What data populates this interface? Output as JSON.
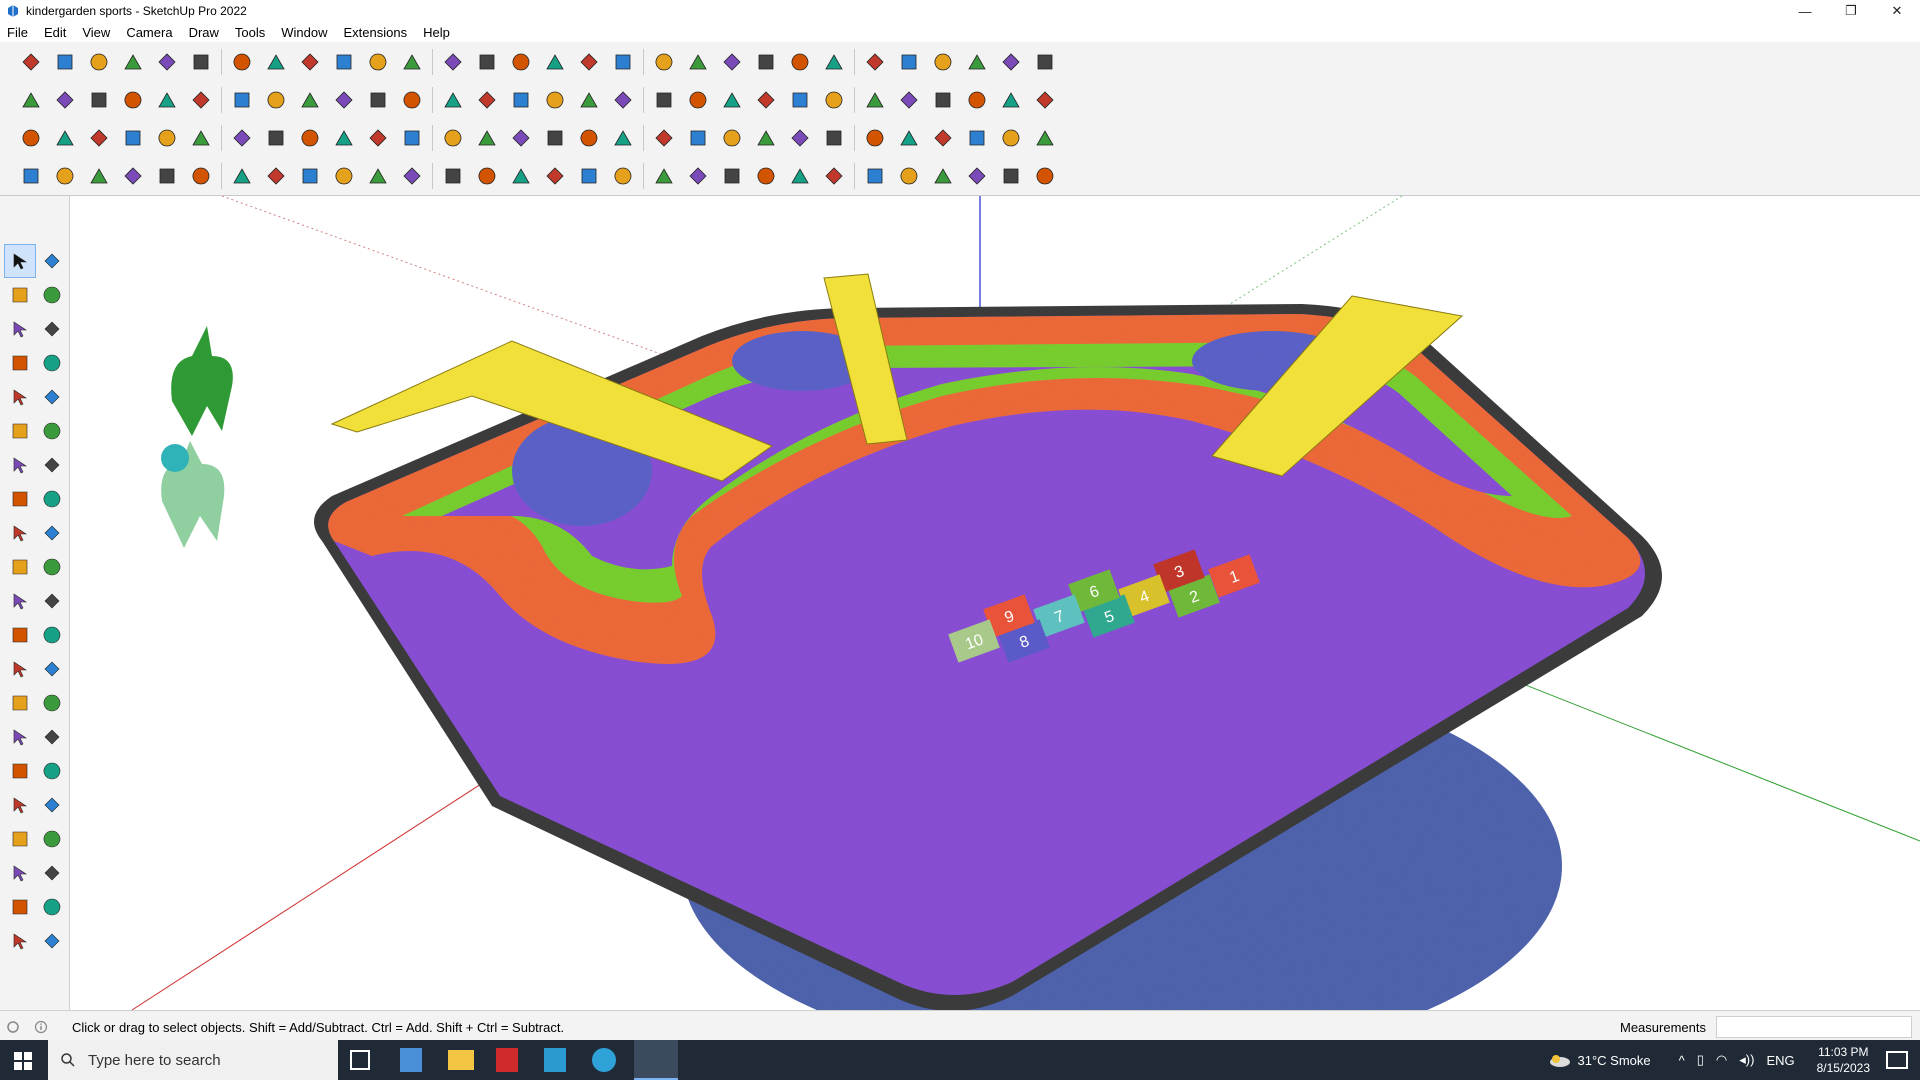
{
  "window": {
    "title": "kindergarden sports - SketchUp Pro 2022",
    "minimize": "—",
    "restore": "❐",
    "close": "✕"
  },
  "menu": [
    "File",
    "Edit",
    "View",
    "Camera",
    "Draw",
    "Tools",
    "Window",
    "Extensions",
    "Help"
  ],
  "toolbar": {
    "row1_icons": [
      "search-icon",
      "select-icon",
      "eraser-icon",
      "line-icon",
      "arc-icon",
      "rectangle-icon",
      "move-icon",
      "rotate-icon",
      "scale-icon",
      "offset-icon",
      "tape-icon",
      "text-icon",
      "paint-icon",
      "orbit-icon",
      "pan-icon",
      "zoom-icon",
      "zoom-extents-icon",
      "previous-icon",
      "next-icon",
      "component-icon",
      "group-icon",
      "layers-icon",
      "styles-icon",
      "shadows-icon",
      "scenes-icon",
      "warehouse-icon",
      "extension-icon",
      "undo-icon",
      "redo-icon",
      "print-icon"
    ],
    "row2_icons": [
      "iso-view-icon",
      "top-view-icon",
      "front-view-icon",
      "right-view-icon",
      "back-view-icon",
      "left-view-icon",
      "bottom-view-icon",
      "axis-x-icon",
      "axis-y-icon",
      "axis-z-icon",
      "box-icon",
      "house-icon",
      "wall-icon",
      "door-icon",
      "window-icon",
      "roof-icon",
      "stairs-icon",
      "text3d-icon",
      "brush-icon",
      "polygon-icon",
      "circle-icon",
      "ellipse-icon",
      "parallelogram-icon",
      "curve-icon",
      "knife-icon",
      "pushpull-icon",
      "follow-icon",
      "intersect-icon",
      "sandbox-icon",
      "terrain-icon"
    ],
    "row3_icons": [
      "solid-union-icon",
      "solid-subtract-icon",
      "solid-trim-icon",
      "solid-split-icon",
      "spiral-icon",
      "cut-icon",
      "plane-icon",
      "join-icon",
      "weld-icon",
      "fillet-icon",
      "chamfer-icon",
      "grid-icon",
      "explode-icon",
      "clean-icon",
      "array-icon",
      "mirror-icon",
      "align-icon",
      "extrude-icon",
      "loft-icon",
      "skin-icon",
      "sweep-icon",
      "bend-icon",
      "twist-icon",
      "stretch-icon",
      "taper-icon",
      "flatten-icon",
      "unfold-icon",
      "subdivide-icon",
      "smooth-icon",
      "crease-icon"
    ],
    "row4_icons": [
      "curve-tool-icon",
      "bezier-icon",
      "paint-bucket-icon",
      "shape-icon",
      "hand-icon",
      "pipe-icon",
      "hose-icon",
      "cube-icon",
      "sphere-icon",
      "cone-icon",
      "cylinder-icon",
      "torus-icon",
      "tube-icon",
      "spring-icon",
      "helix-icon",
      "ribbon-icon",
      "wave-icon",
      "zigzag-icon",
      "ladder-icon",
      "rail-icon",
      "fence-icon",
      "pillar-icon",
      "column-icon",
      "lattice-icon",
      "truss-icon",
      "frame-icon",
      "panel-icon",
      "tile-icon",
      "mesh-icon",
      "cloth-icon"
    ]
  },
  "left_tools": [
    "select-tool-icon",
    "component-tool-icon",
    "paint-tool-icon",
    "eraser-tool-icon",
    "tape-tool-icon",
    "pencil-tool-icon",
    "line-tool-icon",
    "freehand-tool-icon",
    "rectangle-tool-icon",
    "rotated-rect-tool-icon",
    "circle-tool-icon",
    "polygon-tool-icon",
    "arc-tool-icon",
    "2pt-arc-tool-icon",
    "3pt-arc-tool-icon",
    "pie-tool-icon",
    "move-tool-icon",
    "pushpull-tool-icon",
    "rotate-tool-icon",
    "followme-tool-icon",
    "scale-tool-icon",
    "offset-tool-icon",
    "tape-measure-tool-icon",
    "dimension-tool-icon",
    "protractor-tool-icon",
    "text-tool-icon",
    "axes-tool-icon",
    "3dtext-tool-icon",
    "orbit-tool-icon",
    "pan-tool-icon",
    "zoom-tool-icon",
    "zoom-window-tool-icon",
    "zoom-extents-tool-icon",
    "previous-view-tool-icon",
    "position-camera-tool-icon",
    "look-around-tool-icon",
    "walk-tool-icon",
    "section-plane-tool-icon",
    "tags-tool-icon",
    "styles-tool-icon",
    "layers-tool-icon",
    "scenes-tool-icon"
  ],
  "hopscotch": [
    "1",
    "2",
    "3",
    "4",
    "5",
    "6",
    "7",
    "8",
    "9",
    "10"
  ],
  "status": {
    "hint": "Click or drag to select objects. Shift = Add/Subtract. Ctrl = Add. Shift + Ctrl = Subtract.",
    "measurements_label": "Measurements",
    "measurements_value": ""
  },
  "taskbar": {
    "search_placeholder": "Type here to search",
    "weather": "31°C  Smoke",
    "language": "ENG",
    "time": "11:03 PM",
    "date": "8/15/2023"
  },
  "colors": {
    "purple": "#8a4fd6",
    "orange": "#ef6a38",
    "green": "#79d02e",
    "blue": "#5c62c9",
    "yellow": "#f2e03a",
    "border": "#3a3a3a"
  }
}
